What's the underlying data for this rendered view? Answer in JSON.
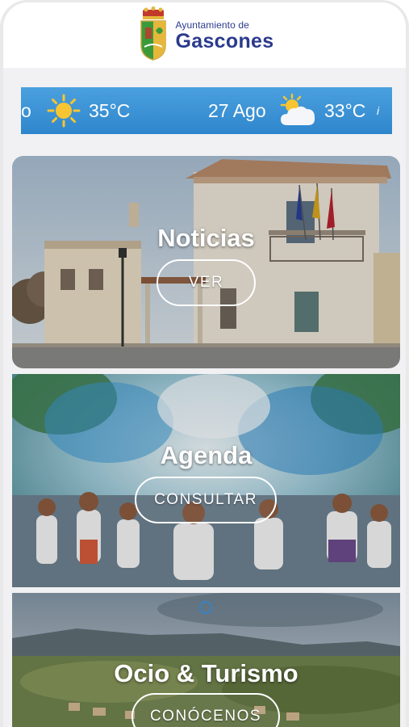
{
  "header": {
    "logo_small": "Ayuntamiento de",
    "logo_big": "Gascones"
  },
  "weather": {
    "partial_text": "o",
    "item1_icon": "sun-icon",
    "item1_temp": "35°C",
    "item2_date": "27 Ago",
    "item2_icon": "partly-cloudy-icon",
    "item2_temp": "33°C",
    "info_glyph": "i"
  },
  "cards": [
    {
      "title": "Noticias",
      "button": "VER"
    },
    {
      "title": "Agenda",
      "button": "CONSULTAR"
    },
    {
      "title": "Ocio & Turismo",
      "button": "CONÓCENOS"
    }
  ],
  "colors": {
    "brand_blue": "#2a3a8c",
    "weather_bar": "#3b93d6",
    "background": "#f1f1f3"
  }
}
